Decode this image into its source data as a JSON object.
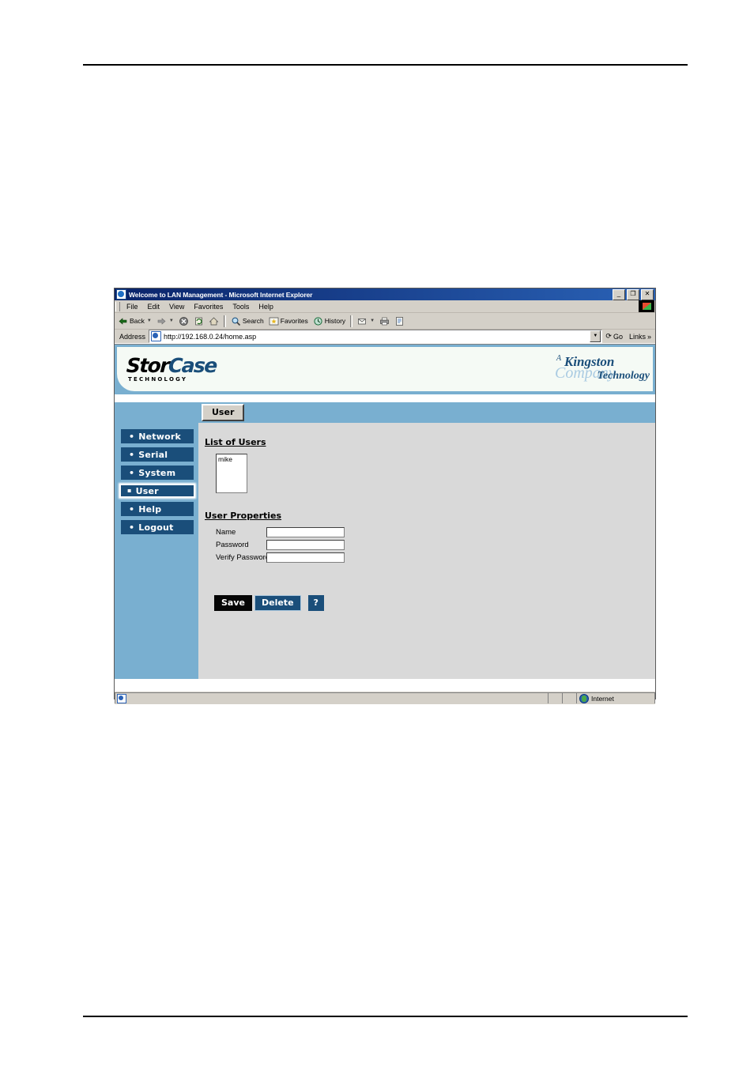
{
  "browser": {
    "title": "Welcome to LAN Management - Microsoft Internet Explorer",
    "window_controls": {
      "minimize": "_",
      "restore": "❐",
      "close": "✕"
    },
    "menu": [
      "File",
      "Edit",
      "View",
      "Favorites",
      "Tools",
      "Help"
    ],
    "toolbar": [
      {
        "label": "Back",
        "icon": "back-arrow-icon",
        "has_caret": true
      },
      {
        "label": "",
        "icon": "forward-arrow-icon",
        "has_caret": true
      },
      {
        "label": "",
        "icon": "stop-icon",
        "has_caret": false
      },
      {
        "label": "",
        "icon": "refresh-icon",
        "has_caret": false
      },
      {
        "label": "",
        "icon": "home-icon",
        "has_caret": false
      },
      {
        "label": "Search",
        "icon": "search-icon",
        "has_caret": false
      },
      {
        "label": "Favorites",
        "icon": "favorites-star-icon",
        "has_caret": false
      },
      {
        "label": "History",
        "icon": "history-clock-icon",
        "has_caret": false
      },
      {
        "label": "",
        "icon": "mail-icon",
        "has_caret": true
      },
      {
        "label": "",
        "icon": "print-icon",
        "has_caret": false
      },
      {
        "label": "",
        "icon": "edit-icon",
        "has_caret": false
      }
    ],
    "address": {
      "label": "Address",
      "value": "http://192.168.0.24/home.asp",
      "placeholder": "",
      "go_label": "Go",
      "links_label": "Links"
    },
    "statusbar": {
      "message": "",
      "zone": "Internet"
    }
  },
  "page": {
    "brand": {
      "name_part1": "Stor",
      "name_part2": "Case",
      "tagline": "TECHNOLOGY",
      "partner_a": "A",
      "partner_kingston": "Kingston",
      "partner_company": "Company",
      "partner_technology": "Technology"
    },
    "tabs": [
      {
        "label": "User",
        "active": true
      }
    ],
    "sidebar": {
      "items": [
        {
          "label": "Network",
          "bullet": "•",
          "selected": false
        },
        {
          "label": "Serial",
          "bullet": "•",
          "selected": false
        },
        {
          "label": "System",
          "bullet": "•",
          "selected": false
        },
        {
          "label": "User",
          "bullet": "▪",
          "selected": true
        },
        {
          "label": "Help",
          "bullet": "•",
          "selected": false
        },
        {
          "label": "Logout",
          "bullet": "•",
          "selected": false
        }
      ]
    },
    "list_of_users": {
      "heading": "List of Users",
      "items": [
        "mike"
      ]
    },
    "user_properties": {
      "heading": "User Properties",
      "fields": [
        {
          "label": "Name",
          "value": "",
          "type": "text"
        },
        {
          "label": "Password",
          "value": "",
          "type": "password"
        },
        {
          "label": "Verify Password",
          "value": "",
          "type": "password"
        }
      ]
    },
    "actions": {
      "save": "Save",
      "delete": "Delete",
      "help": "?"
    },
    "colors": {
      "page_blue": "#79afd0",
      "nav_navy": "#1a4e7a",
      "content_gray": "#d9d9d9",
      "logo_white": "#f5faf5",
      "save_black": "#050505"
    }
  }
}
